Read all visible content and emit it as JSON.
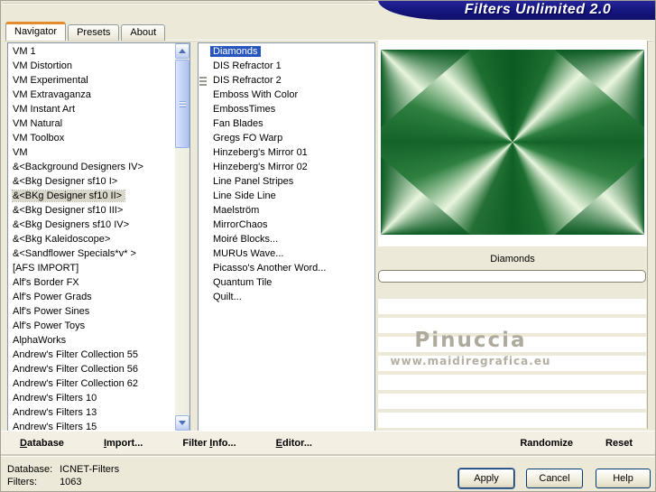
{
  "window": {
    "title": "Filters Unlimited 2.0"
  },
  "tabs": [
    {
      "label": "Navigator",
      "active": true
    },
    {
      "label": "Presets",
      "active": false
    },
    {
      "label": "About",
      "active": false
    }
  ],
  "category_list": {
    "selected_index": 10,
    "items": [
      "VM 1",
      "VM Distortion",
      "VM Experimental",
      "VM Extravaganza",
      "VM Instant Art",
      "VM Natural",
      "VM Toolbox",
      "VM",
      "&<Background Designers IV>",
      "&<Bkg Designer sf10 I>",
      "&<BKg Designer sf10 II>",
      "&<Bkg Designer sf10 III>",
      "&<Bkg Designers sf10 IV>",
      "&<Bkg Kaleidoscope>",
      "&<Sandflower Specials*v* >",
      "[AFS IMPORT]",
      "Alf's Border FX",
      "Alf's Power Grads",
      "Alf's Power Sines",
      "Alf's Power Toys",
      "AlphaWorks",
      "Andrew's Filter Collection 55",
      "Andrew's Filter Collection 56",
      "Andrew's Filter Collection 62",
      "Andrew's Filters 10",
      "Andrew's Filters 13",
      "Andrew's Filters 15"
    ]
  },
  "filter_list": {
    "selected_index": 0,
    "grip_index": 2,
    "items": [
      "Diamonds",
      "DIS Refractor 1",
      "DIS Refractor 2",
      "Emboss With Color",
      "EmbossTimes",
      "Fan Blades",
      "Gregs FO Warp",
      "Hinzeberg's Mirror 01",
      "Hinzeberg's Mirror 02",
      "Line Panel Stripes",
      "Line Side Line",
      "Maelström",
      "MirrorChaos",
      "Moiré Blocks...",
      "MURUs Wave...",
      "Picasso's Another Word...",
      "Quantum Tile",
      "Quilt..."
    ]
  },
  "preview": {
    "caption": "Diamonds",
    "watermark_line1": "Pinuccia",
    "watermark_line2": "www.maidiregrafica.eu"
  },
  "toolbar": {
    "left": [
      {
        "label": "Database",
        "u": 0
      },
      {
        "label": "Import...",
        "u": 0
      },
      {
        "label": "Filter Info...",
        "u": 7
      },
      {
        "label": "Editor...",
        "u": 0
      }
    ],
    "right": [
      {
        "label": "Randomize",
        "u": null
      },
      {
        "label": "Reset",
        "u": null
      }
    ]
  },
  "status": {
    "database_label": "Database:",
    "database_value": "ICNET-Filters",
    "filters_label": "Filters:",
    "filters_value": "1063"
  },
  "action_buttons": {
    "apply": "Apply",
    "cancel": "Cancel",
    "help": "Help"
  },
  "colors": {
    "background": "#ECE9D8",
    "banner_navy": "#15157E",
    "tab_accent_orange": "#E68B2C",
    "selection_blue": "#2856C0",
    "inactive_selection": "#D9D6CA",
    "pattern_dark_green": "#0A5A22",
    "pattern_light_green": "#E9F5DF"
  }
}
